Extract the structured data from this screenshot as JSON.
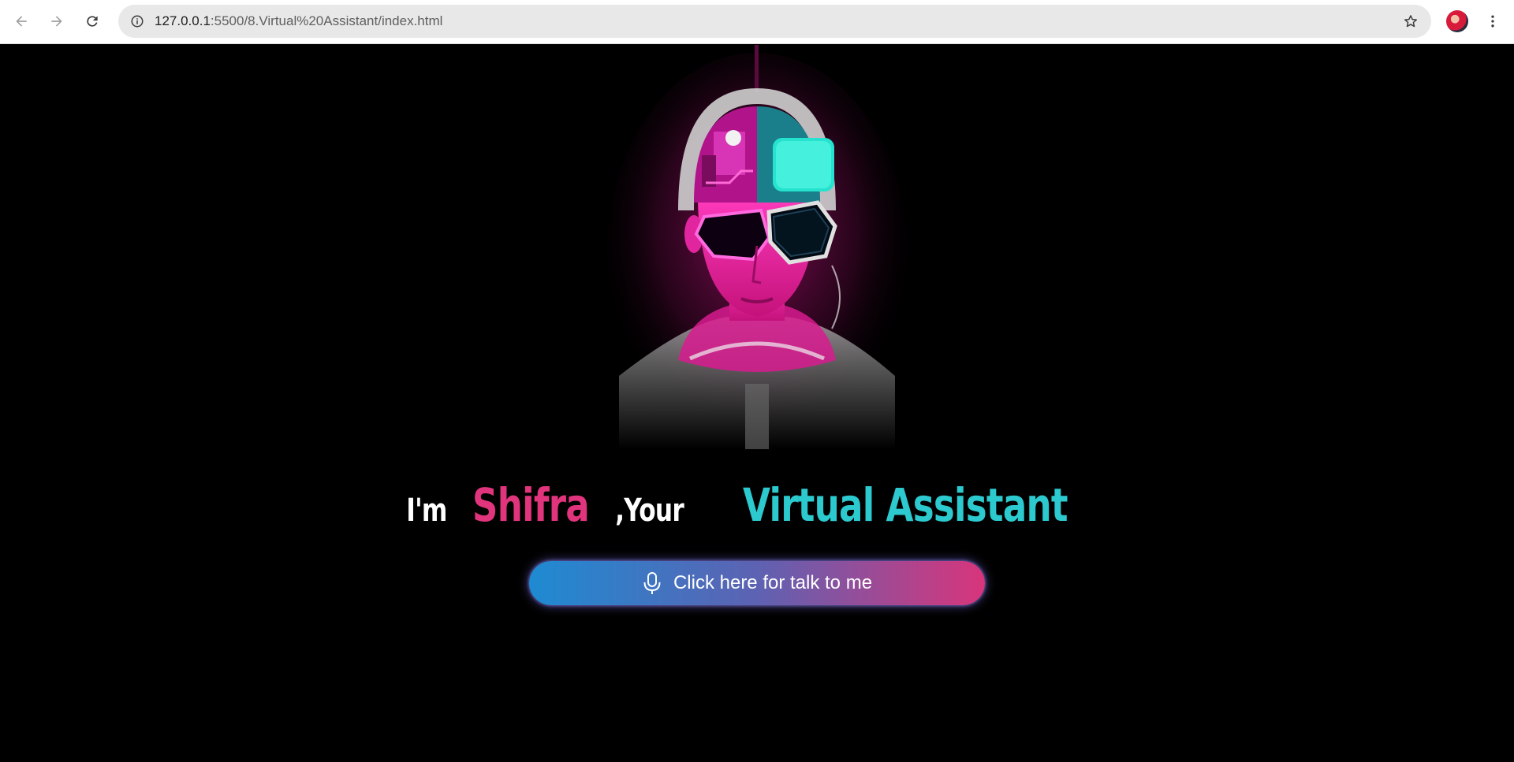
{
  "browser": {
    "url_host": "127.0.0.1",
    "url_path": ":5500/8.Virtual%20Assistant/index.html",
    "icons": [
      "back-icon",
      "forward-icon",
      "reload-icon",
      "site-info-icon",
      "bookmark-star-icon",
      "profile-avatar",
      "more-menu-icon"
    ]
  },
  "hero": {
    "image": "cyberpunk-assistant-portrait",
    "colors": {
      "magenta": "#ff1aa8",
      "cyan": "#2ee6d6",
      "background": "#000000"
    }
  },
  "headline": {
    "prefix": "I'm",
    "name": "Shifra",
    "middle": ",Your",
    "title": "Virtual Assistant",
    "colors": {
      "prefix": "#ffffff",
      "name": "#e0347c",
      "title": "#2cc9cf"
    }
  },
  "talk_button": {
    "label": "Click here for talk to me",
    "icon": "microphone-icon",
    "gradient": [
      "#1e8bd2",
      "#5d62b2",
      "#d8357b"
    ]
  }
}
